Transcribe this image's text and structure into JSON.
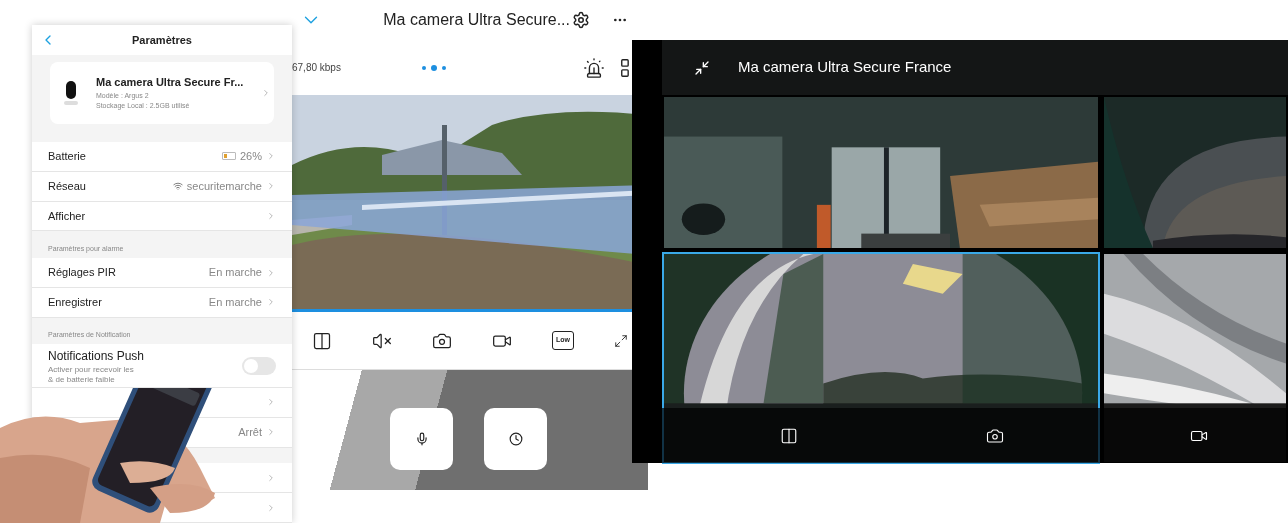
{
  "settings": {
    "title": "Paramètres",
    "device": {
      "name": "Ma camera Ultra Secure Fr...",
      "model": "Modèle : Argus 2",
      "storage": "Stockage Local : 2.5GB utilisé"
    },
    "items": [
      {
        "kind": "battery",
        "label": "Batterie",
        "value": "26%",
        "level": 0.26
      },
      {
        "kind": "wifi",
        "label": "Réseau",
        "value": "securitemarche"
      },
      {
        "kind": "row",
        "label": "Afficher"
      },
      {
        "kind": "header",
        "label": "Paramètres pour alarme"
      },
      {
        "kind": "row",
        "label": "Réglages PIR",
        "value": "En marche"
      },
      {
        "kind": "row",
        "label": "Enregistrer",
        "value": "En marche"
      },
      {
        "kind": "header",
        "label": "Paramètres de Notification"
      },
      {
        "kind": "toggle",
        "label": "Notifications Push",
        "note": "Activer pour recevoir les",
        "note2": "& de batterie faible",
        "on": false
      },
      {
        "kind": "row"
      },
      {
        "kind": "row",
        "value": "Arrêt"
      },
      {
        "kind": "gap"
      },
      {
        "kind": "row"
      },
      {
        "kind": "row"
      }
    ]
  },
  "live": {
    "title": "Ma camera Ultra Secure...",
    "bitrate": "67,80 kbps",
    "dots": [
      {
        "selected": false
      },
      {
        "selected": true
      },
      {
        "selected": false
      }
    ],
    "quality": "Low",
    "actions": [
      {
        "kind": "mic"
      },
      {
        "kind": "clock"
      }
    ]
  },
  "fullscreen": {
    "title": "Ma camera Ultra Secure France",
    "cells": [
      {
        "kind": "indoor",
        "selected": false
      },
      {
        "kind": "storm",
        "selected": false
      },
      {
        "kind": "sky",
        "selected": true
      },
      {
        "kind": "swirl",
        "selected": false
      }
    ]
  }
}
